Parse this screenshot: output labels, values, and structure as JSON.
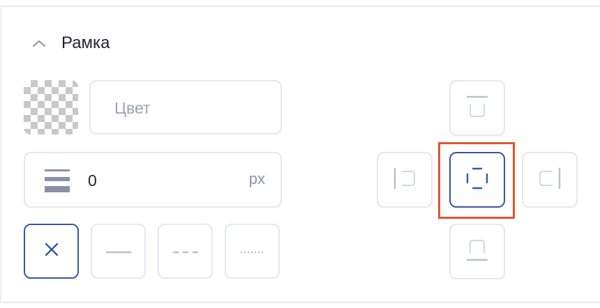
{
  "section": {
    "title": "Рамка",
    "collapse_icon": "chevron-up-icon"
  },
  "color": {
    "placeholder": "Цвет",
    "value": "",
    "swatch_icon": "transparent-checker-swatch"
  },
  "border_width": {
    "icon": "line-width-icon",
    "value": "0",
    "unit": "px"
  },
  "styles": [
    {
      "id": "none",
      "icon": "close-icon",
      "selected": true
    },
    {
      "id": "solid",
      "icon": "solid-line-icon",
      "selected": false
    },
    {
      "id": "dashed",
      "icon": "dashed-line-icon",
      "selected": false
    },
    {
      "id": "dotted",
      "icon": "dotted-line-icon",
      "selected": false
    }
  ],
  "sides": [
    {
      "id": "top",
      "icon": "border-top-icon",
      "selected": false
    },
    {
      "id": "left",
      "icon": "border-left-icon",
      "selected": false
    },
    {
      "id": "all",
      "icon": "border-all-icon",
      "selected": true
    },
    {
      "id": "right",
      "icon": "border-right-icon",
      "selected": false
    },
    {
      "id": "bottom",
      "icon": "border-bottom-icon",
      "selected": false
    }
  ],
  "colors": {
    "accent": "#3556a8",
    "border": "#e4e7ee",
    "muted_icon": "#b9bfcc",
    "highlight": "#e2542f",
    "text": "#1f2430",
    "placeholder": "#9aa2b6"
  }
}
